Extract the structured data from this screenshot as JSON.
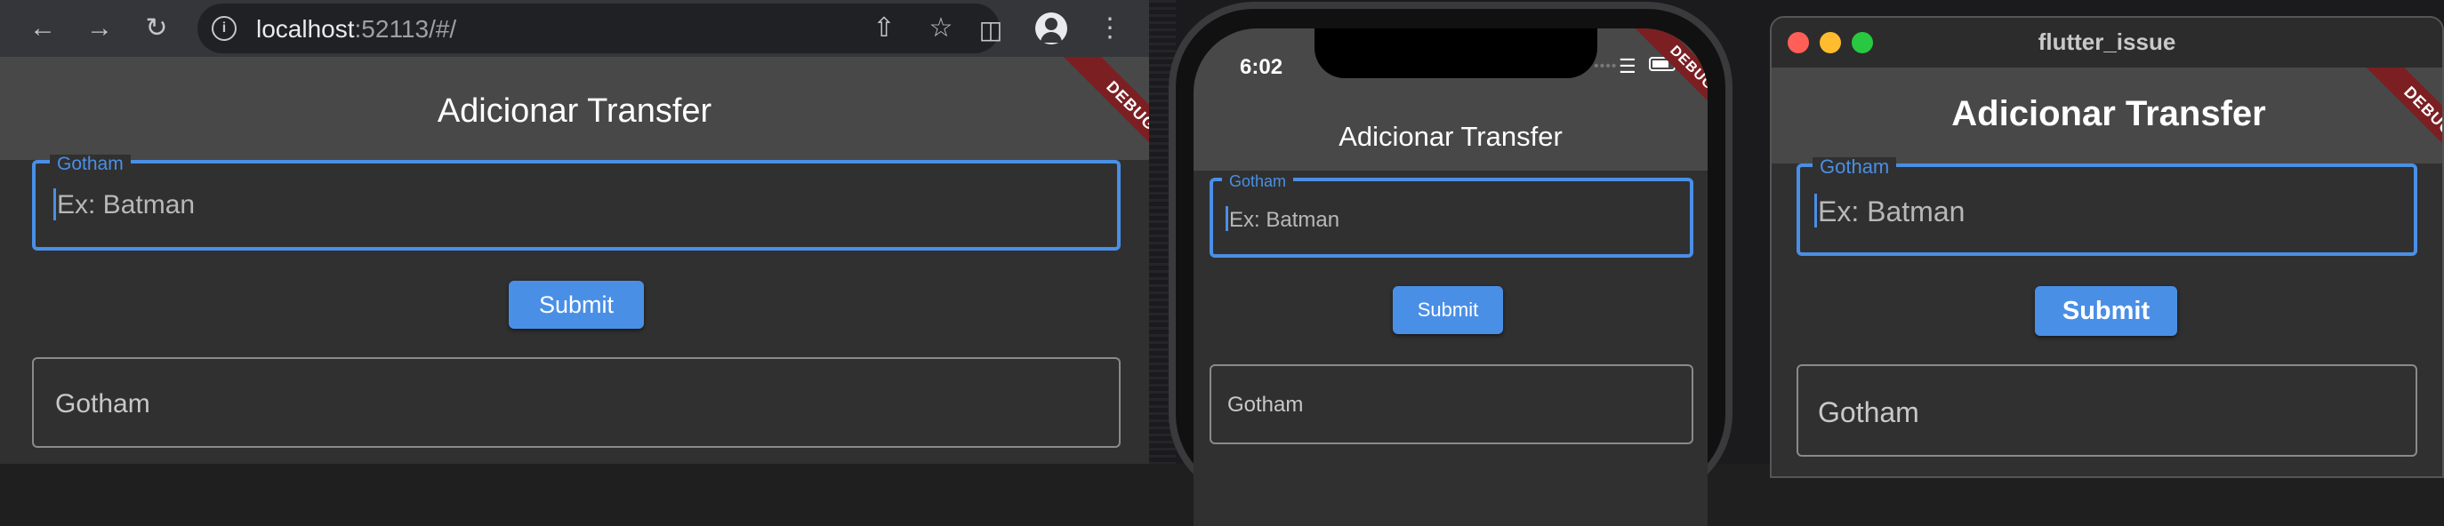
{
  "browser": {
    "url_host": "localhost",
    "url_rest": ":52113/#/",
    "back_icon": "arrow-left-icon",
    "forward_icon": "arrow-right-icon",
    "reload_icon": "reload-icon",
    "app": {
      "title": "Adicionar Transfer",
      "field_label": "Gotham",
      "field_hint": "Ex: Batman",
      "button": "Submit",
      "second_field_value": "Gotham",
      "debug": "DEBUG"
    }
  },
  "phone": {
    "time": "6:02",
    "app": {
      "title": "Adicionar Transfer",
      "field_label": "Gotham",
      "field_hint": "Ex: Batman",
      "button": "Submit",
      "second_field_value": "Gotham",
      "debug": "DEBUG"
    }
  },
  "mac": {
    "window_title": "flutter_issue",
    "traffic_lights": {
      "close": "#ff5f57",
      "minimize": "#febc2e",
      "zoom": "#28c840"
    },
    "app": {
      "title": "Adicionar Transfer",
      "field_label": "Gotham",
      "field_hint": "Ex: Batman",
      "button": "Submit",
      "second_field_value": "Gotham",
      "debug": "DEBUG"
    }
  },
  "colors": {
    "accent": "#4a8fe6",
    "appbar": "#484848",
    "debug_banner": "#7b1f23"
  }
}
